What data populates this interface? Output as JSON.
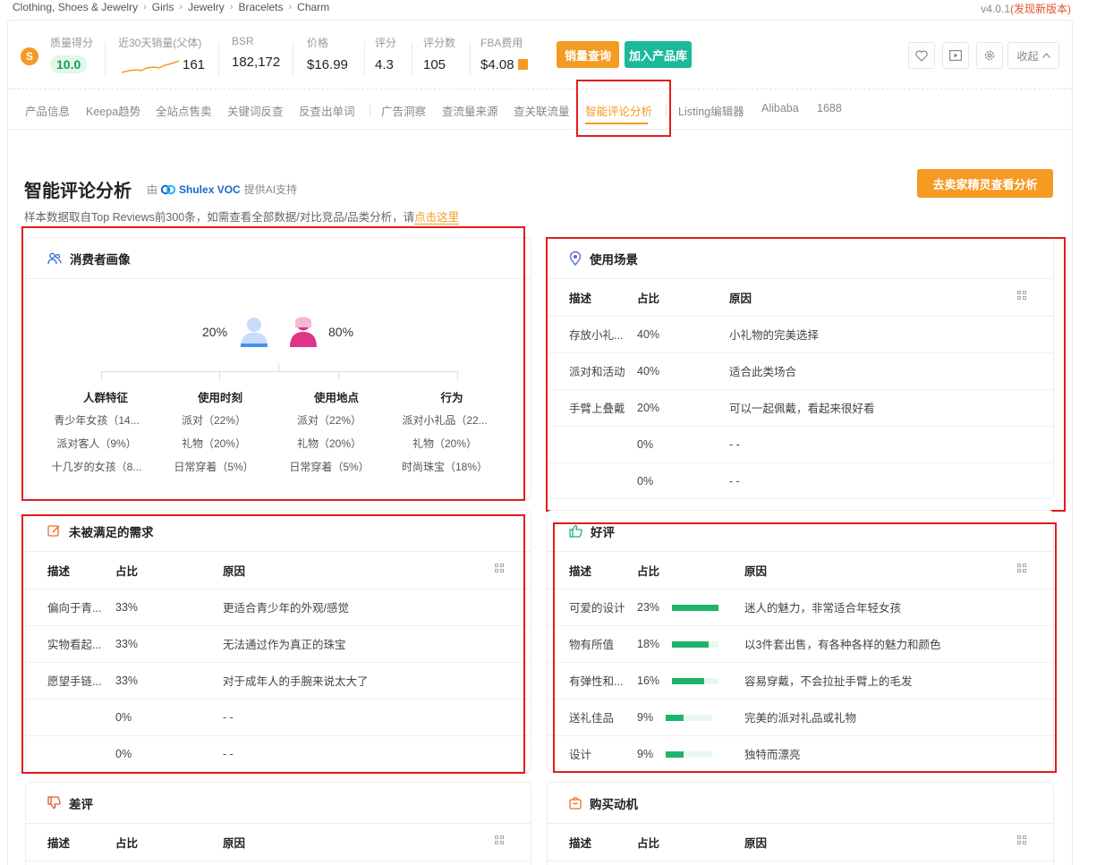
{
  "breadcrumb": [
    "Clothing, Shoes & Jewelry",
    "Girls",
    "Jewelry",
    "Bracelets",
    "Charm"
  ],
  "version": {
    "number": "v4.0.1",
    "update_text": "(发现新版本)"
  },
  "metrics": {
    "quality_label": "质量得分",
    "quality_value": "10.0",
    "sales_label": "近30天销量(父体)",
    "sales_value": "161",
    "bsr_label": "BSR",
    "bsr_value": "182,172",
    "price_label": "价格",
    "price_value": "$16.99",
    "rating_label": "评分",
    "rating_value": "4.3",
    "reviews_label": "评分数",
    "reviews_value": "105",
    "fba_label": "FBA费用",
    "fba_value": "$4.08"
  },
  "actions": {
    "sales_query": "销量查询",
    "add_library": "加入产品库",
    "collapse": "收起"
  },
  "tabs": [
    "产品信息",
    "Keepa趋势",
    "全站点售卖",
    "关键词反查",
    "反查出单词",
    "广告洞察",
    "查流量来源",
    "查关联流量",
    "智能评论分析",
    "Listing编辑器",
    "Alibaba",
    "1688"
  ],
  "page": {
    "title": "智能评论分析",
    "by": "由",
    "brand": "Shulex VOC",
    "by_suffix": "提供AI支持",
    "subtitle": "样本数据取自Top Reviews前300条，如需查看全部数据/对比竞品/品类分析，请",
    "subtitle_link": "点击这里",
    "seller_button": "去卖家精灵查看分析"
  },
  "table_headers": {
    "desc": "描述",
    "share": "占比",
    "reason": "原因"
  },
  "persona": {
    "title": "消费者画像",
    "male_pct": "20%",
    "female_pct": "80%",
    "columns": [
      {
        "title": "人群特征",
        "items": [
          "青少年女孩（14...",
          "派对客人（9%）",
          "十几岁的女孩（8..."
        ]
      },
      {
        "title": "使用时刻",
        "items": [
          "派对（22%）",
          "礼物（20%）",
          "日常穿着（5%）"
        ]
      },
      {
        "title": "使用地点",
        "items": [
          "派对（22%）",
          "礼物（20%）",
          "日常穿着（5%）"
        ]
      },
      {
        "title": "行为",
        "items": [
          "派对小礼品（22...",
          "礼物（20%）",
          "时尚珠宝（18%）"
        ]
      }
    ]
  },
  "usage": {
    "title": "使用场景",
    "rows": [
      {
        "desc": "存放小礼...",
        "share": "40%",
        "reason": "小礼物的完美选择"
      },
      {
        "desc": "派对和活动",
        "share": "40%",
        "reason": "适合此类场合"
      },
      {
        "desc": "手臂上叠戴",
        "share": "20%",
        "reason": "可以一起佩戴，看起来很好看"
      },
      {
        "desc": "",
        "share": "0%",
        "reason": "- -"
      },
      {
        "desc": "",
        "share": "0%",
        "reason": "- -"
      }
    ]
  },
  "unmet": {
    "title": "未被满足的需求",
    "rows": [
      {
        "desc": "偏向于青...",
        "share": "33%",
        "reason": "更适合青少年的外观/感觉"
      },
      {
        "desc": "实物看起...",
        "share": "33%",
        "reason": "无法通过作为真正的珠宝"
      },
      {
        "desc": "愿望手链...",
        "share": "33%",
        "reason": "对于成年人的手腕来说太大了"
      },
      {
        "desc": "",
        "share": "0%",
        "reason": "- -"
      },
      {
        "desc": "",
        "share": "0%",
        "reason": "- -"
      }
    ]
  },
  "positive": {
    "title": "好评",
    "rows": [
      {
        "desc": "可爱的设计",
        "share": "23%",
        "bar": 1.0,
        "reason": "迷人的魅力，非常适合年轻女孩"
      },
      {
        "desc": "物有所值",
        "share": "18%",
        "bar": 0.78,
        "reason": "以3件套出售，有各种各样的魅力和颜色"
      },
      {
        "desc": "有弹性和...",
        "share": "16%",
        "bar": 0.7,
        "reason": "容易穿戴，不会拉扯手臂上的毛发"
      },
      {
        "desc": "送礼佳品",
        "share": "9%",
        "bar": 0.39,
        "reason": "完美的派对礼品或礼物"
      },
      {
        "desc": "设计",
        "share": "9%",
        "bar": 0.39,
        "reason": "独特而漂亮"
      }
    ]
  },
  "negative": {
    "title": "差评"
  },
  "motivation": {
    "title": "购买动机"
  },
  "colors": {
    "accent": "#f59a23",
    "teal": "#1bb99a",
    "green": "#1fb46d",
    "highlight": "#e11d1d",
    "male": "#4a8ef0",
    "female": "#e0338a"
  }
}
